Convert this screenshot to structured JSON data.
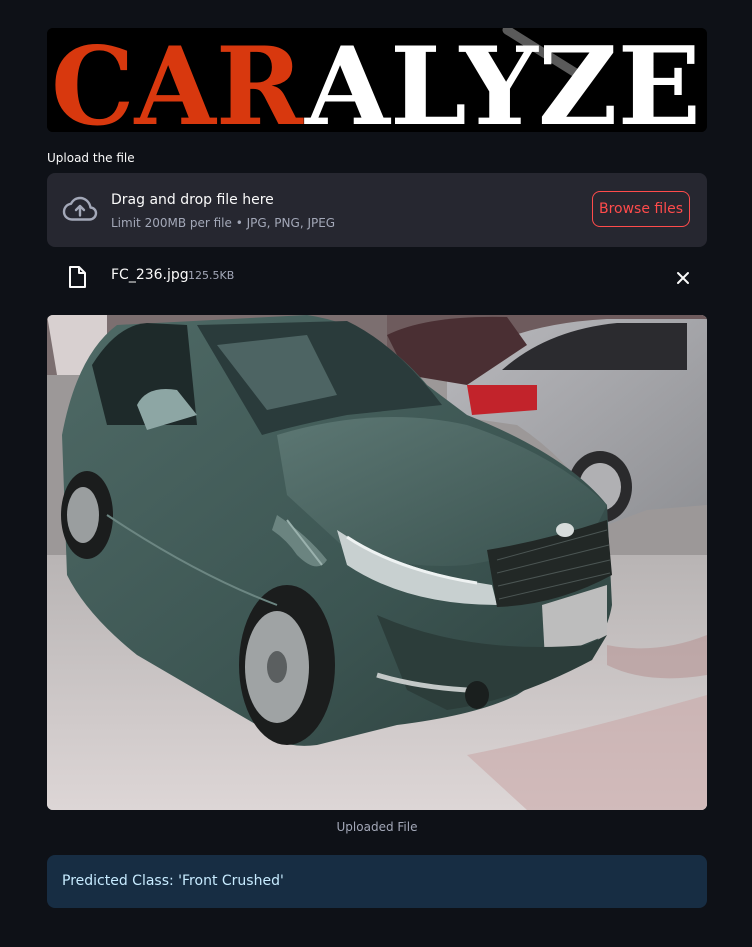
{
  "logo": {
    "part1": "CAR",
    "part2": "ALYZE",
    "part1_color": "#d8380e",
    "part2_color": "#ffffff"
  },
  "uploader": {
    "label": "Upload the file",
    "dropzone_title": "Drag and drop file here",
    "dropzone_subtitle": "Limit 200MB per file • JPG, PNG, JPEG",
    "browse_label": "Browse files",
    "icon": "cloud-upload-icon"
  },
  "file": {
    "name": "FC_236.jpg",
    "size": "125.5KB",
    "icon": "file-icon",
    "remove_icon": "close-icon"
  },
  "image": {
    "caption": "Uploaded File"
  },
  "result": {
    "text": "Predicted Class: 'Front Crushed'"
  },
  "colors": {
    "background": "#0e1117",
    "dropzone": "#262730",
    "accent": "#ff4b4b",
    "info_bg": "#172d43",
    "info_text": "#c7ebff"
  }
}
